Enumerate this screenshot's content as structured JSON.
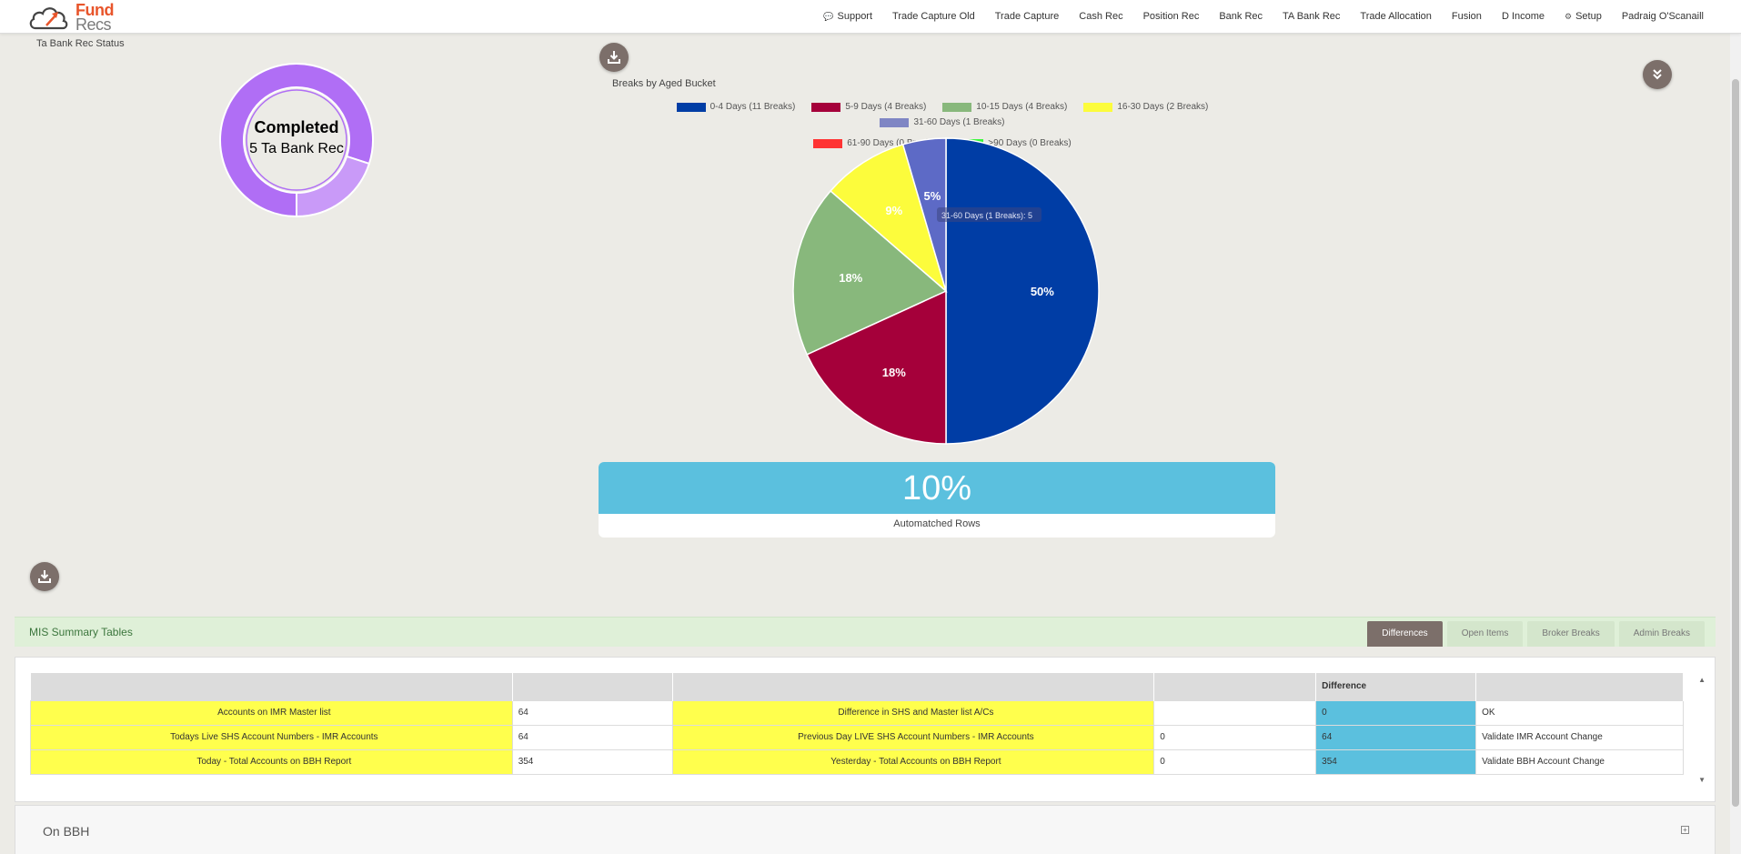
{
  "logo": {
    "line1": "Fund",
    "line2": "Recs"
  },
  "nav": [
    {
      "label": "Support",
      "icon": "chat-icon"
    },
    {
      "label": "Trade Capture Old"
    },
    {
      "label": "Trade Capture"
    },
    {
      "label": "Cash Rec"
    },
    {
      "label": "Position Rec"
    },
    {
      "label": "Bank Rec"
    },
    {
      "label": "TA Bank Rec"
    },
    {
      "label": "Trade Allocation"
    },
    {
      "label": "Fusion"
    },
    {
      "label": "D Income"
    },
    {
      "label": "Setup",
      "icon": "gears-icon"
    },
    {
      "label": "Padraig O'Scanaill"
    }
  ],
  "status": {
    "title": "Ta Bank Rec Status",
    "label_bold": "Completed",
    "label_sub": "5 Ta Bank Rec",
    "completed_fraction": 0.8,
    "colors": {
      "main": "#b06ef5",
      "secondary": "#c99af8"
    }
  },
  "chart_data": {
    "type": "pie",
    "title": "Breaks by Aged Bucket",
    "categories": [
      "0-4 Days (11 Breaks)",
      "5-9 Days (4 Breaks)",
      "10-15 Days (4 Breaks)",
      "16-30 Days (2 Breaks)",
      "31-60 Days (1 Breaks)",
      "61-90 Days (0 Breaks)",
      ">90 Days (0 Breaks)"
    ],
    "values": [
      11,
      4,
      4,
      2,
      1,
      0,
      0
    ],
    "labels": [
      "50%",
      "18%",
      "18%",
      "9%",
      "5%",
      "",
      ""
    ],
    "legend_colors": [
      "#003da5",
      "#a5003a",
      "#88b87c",
      "#fcfc3c",
      "#7f86c4",
      "#ff3333",
      "#3cf63c"
    ],
    "slice_colors": [
      "#003da5",
      "#a5003a",
      "#88b87c",
      "#fcfc3c",
      "#5d6ac6",
      "#ff3333",
      "#3cf63c"
    ],
    "tooltip": "31-60 Days (1 Breaks): 5",
    "legend_position": "top"
  },
  "automatched": {
    "value": "10%",
    "label": "Automatched Rows"
  },
  "mis": {
    "title": "MIS Summary Tables",
    "tabs": [
      "Differences",
      "Open Items",
      "Broker Breaks",
      "Admin Breaks"
    ],
    "active_tab": 0,
    "header": [
      "",
      "",
      "",
      "",
      "Difference",
      ""
    ],
    "rows": [
      [
        "Accounts on IMR Master list",
        "64",
        "Difference in SHS and Master list A/Cs",
        "",
        "0",
        "OK"
      ],
      [
        "Todays Live SHS Account Numbers - IMR Accounts",
        "64",
        "Previous Day LIVE SHS Account Numbers - IMR Accounts",
        "0",
        "64",
        "Validate IMR Account Change"
      ],
      [
        "Today - Total Accounts on BBH Report",
        "354",
        "Yesterday - Total Accounts on BBH Report",
        "0",
        "354",
        "Validate BBH Account Change"
      ]
    ]
  },
  "onbbh": {
    "title": "On BBH"
  }
}
